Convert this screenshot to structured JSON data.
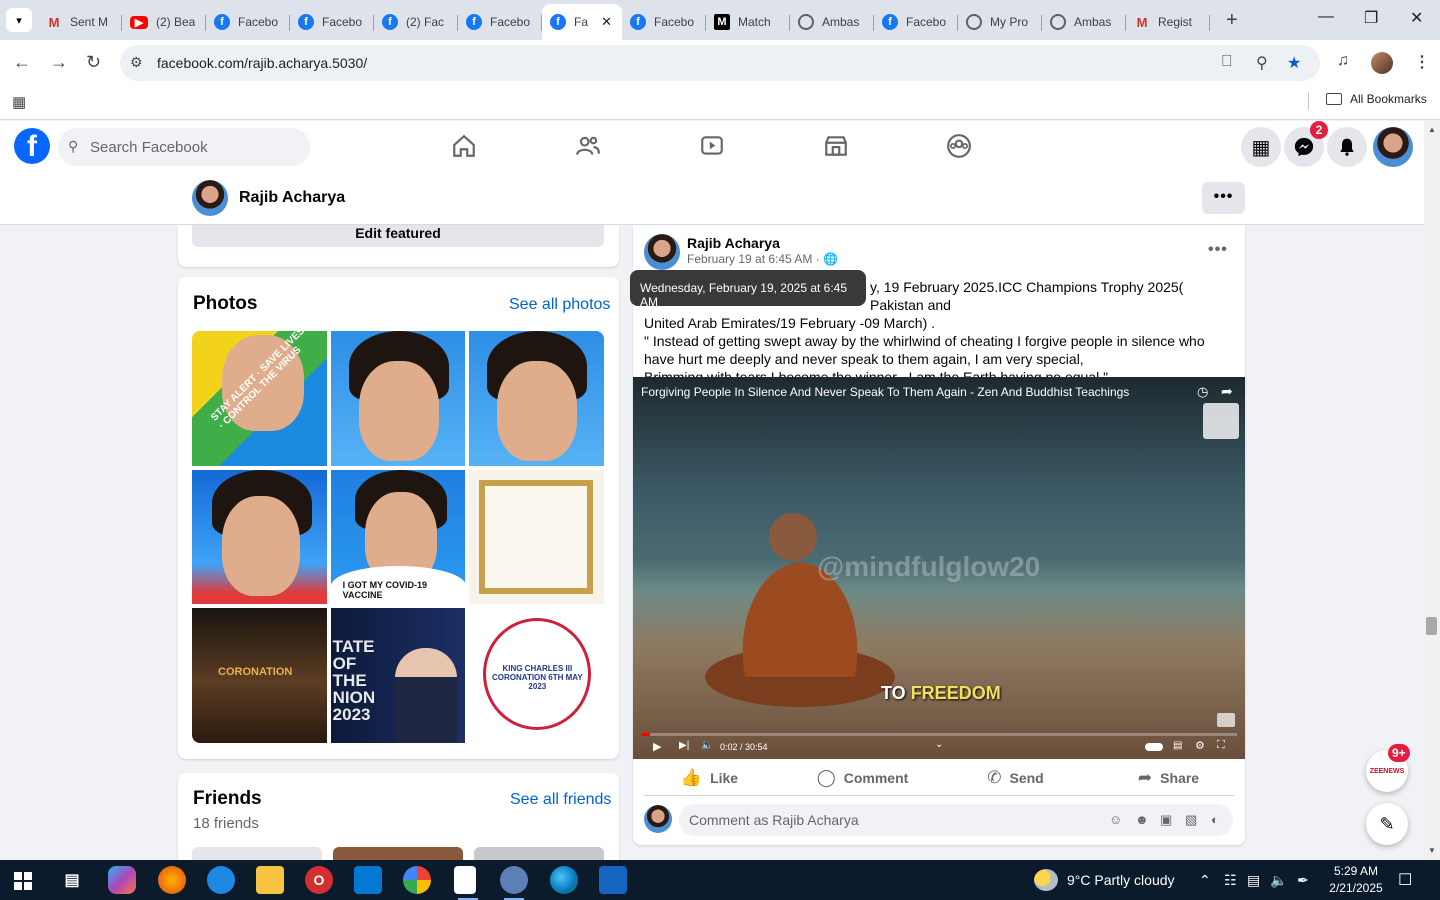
{
  "browser": {
    "tabs": [
      {
        "label": "Sent M",
        "favicon": "gmail-icon"
      },
      {
        "label": "(2) Bea",
        "favicon": "youtube-icon"
      },
      {
        "label": "Facebo",
        "favicon": "facebook-icon"
      },
      {
        "label": "Facebo",
        "favicon": "facebook-icon"
      },
      {
        "label": "(2) Fac",
        "favicon": "facebook-icon"
      },
      {
        "label": "Facebo",
        "favicon": "facebook-icon"
      },
      {
        "label": "Fa",
        "favicon": "facebook-icon",
        "active": true
      },
      {
        "label": "Facebo",
        "favicon": "facebook-icon"
      },
      {
        "label": "Match",
        "favicon": "match-icon"
      },
      {
        "label": "Ambas",
        "favicon": "globe-icon"
      },
      {
        "label": "Facebo",
        "favicon": "facebook-icon"
      },
      {
        "label": "My Pro",
        "favicon": "globe-icon"
      },
      {
        "label": "Ambas",
        "favicon": "globe-icon"
      },
      {
        "label": "Regist",
        "favicon": "gmail-icon"
      }
    ],
    "url": "facebook.com/rajib.acharya.5030/",
    "bookmarks_all": "All Bookmarks"
  },
  "fb": {
    "search_placeholder": "Search Facebook",
    "messenger_badge": "2",
    "profile_name": "Rajib Acharya",
    "edit_featured": "Edit featured",
    "photos": {
      "title": "Photos",
      "see_all": "See all photos",
      "tiles": [
        {
          "caption": "STAY ALERT · SAVE LIVES · CONTROL THE VIRUS"
        },
        {
          "caption": ""
        },
        {
          "caption": ""
        },
        {
          "caption": ""
        },
        {
          "caption": "I GOT MY COVID-19 VACCINE"
        },
        {
          "caption": ""
        },
        {
          "caption": "CORONATION"
        },
        {
          "caption": "TATE OF THE NION 2023"
        },
        {
          "caption": "KING CHARLES III CORONATION 6TH MAY 2023"
        }
      ]
    },
    "friends": {
      "title": "Friends",
      "see_all": "See all friends",
      "count": "18 friends"
    },
    "post": {
      "author": "Rajib Acharya",
      "date": "February 19 at 6:45 AM · ",
      "tooltip": "Wednesday, February 19, 2025 at 6:45 AM",
      "text_line1": "y, 19 February 2025.ICC Champions Trophy 2025( Pakistan and",
      "text_line2": "United Arab Emirates/19 February -09 March) .",
      "text_line3": "\" Instead of getting swept away by the whirlwind of cheating I  forgive people in silence who have hurt me deeply and never speak to them again, I am very special,",
      "text_line4": "Brimming with tears I become the winner ,  I am the Earth having no equal.\"",
      "video": {
        "title": "Forgiving People In Silence And Never Speak To Them Again - Zen And Buddhist Teachings",
        "watermark": "@mindfulglow20",
        "subtitle_a": "TO",
        "subtitle_b": "FREEDOM",
        "time": "0:02 / 30:54",
        "progress": 0.001
      },
      "actions": {
        "like": "Like",
        "comment": "Comment",
        "send": "Send",
        "share": "Share"
      },
      "comment_placeholder": "Comment as Rajib Acharya"
    },
    "float_badge": "9+",
    "float_chat_label": "ZEENEWS"
  },
  "taskbar": {
    "weather": "9°C  Partly cloudy",
    "time": "5:29 AM",
    "date": "2/21/2025"
  },
  "colors": {
    "facebook_blue": "#0866ff",
    "link_blue": "#0064d1",
    "badge_red": "#e41e3f",
    "taskbar": "#0b1b2b"
  }
}
